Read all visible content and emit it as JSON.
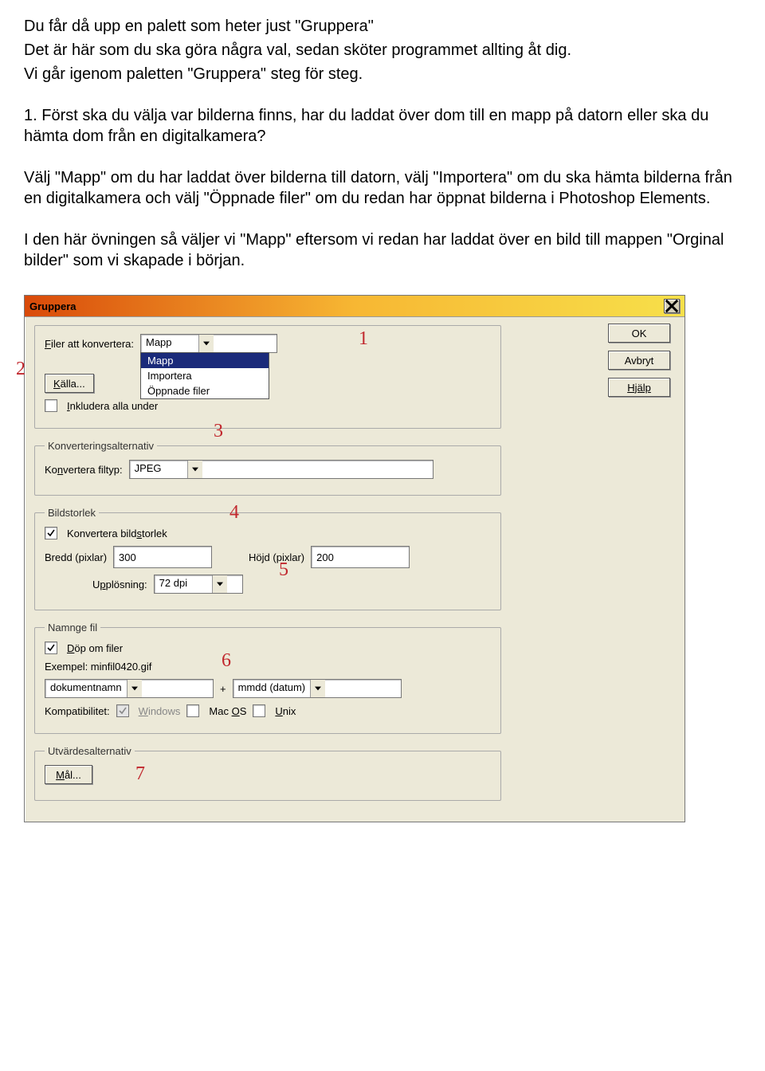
{
  "doc": {
    "p1a": "Du får då upp en palett som heter just \"Gruppera\"",
    "p1b": "Det är här som du ska göra några val, sedan sköter programmet allting åt dig.",
    "p1c": "Vi går igenom paletten \"Gruppera\" steg för steg.",
    "p2": "1. Först ska du välja var bilderna finns, har du laddat över dom till en mapp på datorn eller ska du hämta dom från en digitalkamera?",
    "p3": "Välj \"Mapp\" om du har laddat över bilderna till datorn, välj \"Importera\" om du ska hämta bilderna från en digitalkamera och välj \"Öppnade filer\" om du redan har öppnat bilderna i Photoshop Elements.",
    "p4": "I den här övningen så väljer vi \"Mapp\" eftersom vi redan har laddat över en bild till mappen \"Orginal bilder\" som vi skapade i början."
  },
  "dialog": {
    "title": "Gruppera",
    "buttons": {
      "ok": "OK",
      "cancel": "Avbryt",
      "help": "Hjälp"
    },
    "files": {
      "label": "Filer att konvertera:",
      "value": "Mapp",
      "options": [
        "Mapp",
        "Importera",
        "Öppnade filer"
      ],
      "source_btn": "Källa...",
      "include_sub": "Inkludera alla under"
    },
    "convert": {
      "legend": "Konverteringsalternativ",
      "filetype_label": "Konvertera filtyp:",
      "filetype_value": "JPEG"
    },
    "size": {
      "legend": "Bildstorlek",
      "chk": "Konvertera bildstorlek",
      "width_label": "Bredd (pixlar)",
      "width_value": "300",
      "height_label": "Höjd (pixlar)",
      "height_value": "200",
      "res_label": "Upplösning:",
      "res_value": "72 dpi"
    },
    "naming": {
      "legend": "Namnge fil",
      "rename_chk": "Döp om filer",
      "example": "Exempel: minfil0420.gif",
      "part1": "dokumentnamn",
      "plus": "+",
      "part2": "mmdd (datum)",
      "compat_label": "Kompatibilitet:",
      "win": "Windows",
      "mac": "Mac OS",
      "unix": "Unix"
    },
    "output": {
      "legend": "Utvärdesalternativ",
      "dest_btn": "Mål..."
    }
  },
  "anno": {
    "a1": "1",
    "a2": "2",
    "a3": "3",
    "a4": "4",
    "a5": "5",
    "a6": "6",
    "a7": "7"
  }
}
